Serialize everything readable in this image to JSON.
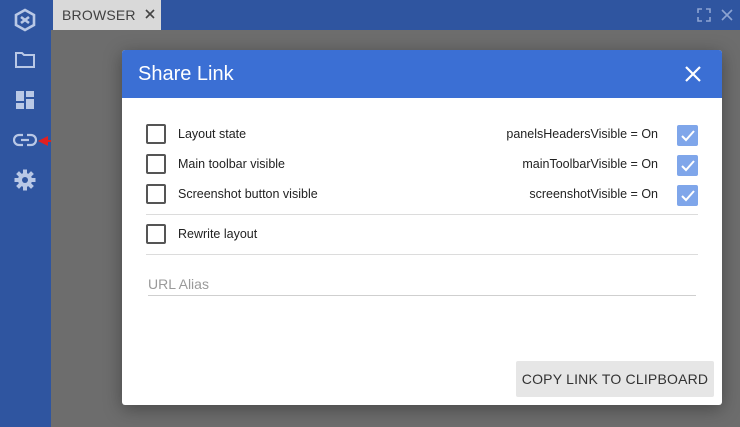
{
  "tab": {
    "label": "BROWSER"
  },
  "sidebar": {
    "items": [
      {
        "icon": "logo-icon"
      },
      {
        "icon": "folder-icon"
      },
      {
        "icon": "dashboard-icon"
      },
      {
        "icon": "link-icon"
      },
      {
        "icon": "gear-icon"
      }
    ]
  },
  "dialog": {
    "title": "Share Link",
    "options": [
      {
        "label": "Layout state",
        "status": "panelsHeadersVisible = On",
        "checked": false,
        "status_checked": true
      },
      {
        "label": "Main toolbar visible",
        "status": "mainToolbarVisible = On",
        "checked": false,
        "status_checked": true
      },
      {
        "label": "Screenshot button visible",
        "status": "screenshotVisible = On",
        "checked": false,
        "status_checked": true
      }
    ],
    "rewrite": {
      "label": "Rewrite layout",
      "checked": false
    },
    "alias": {
      "placeholder": "URL Alias",
      "value": ""
    },
    "copy_button": "COPY LINK TO CLIPBOARD"
  },
  "colors": {
    "sidebar": "#2f55a0",
    "dialog_header": "#3b6fd4",
    "checked_box": "#7fa6ea",
    "annotation_arrow": "#e02020"
  }
}
